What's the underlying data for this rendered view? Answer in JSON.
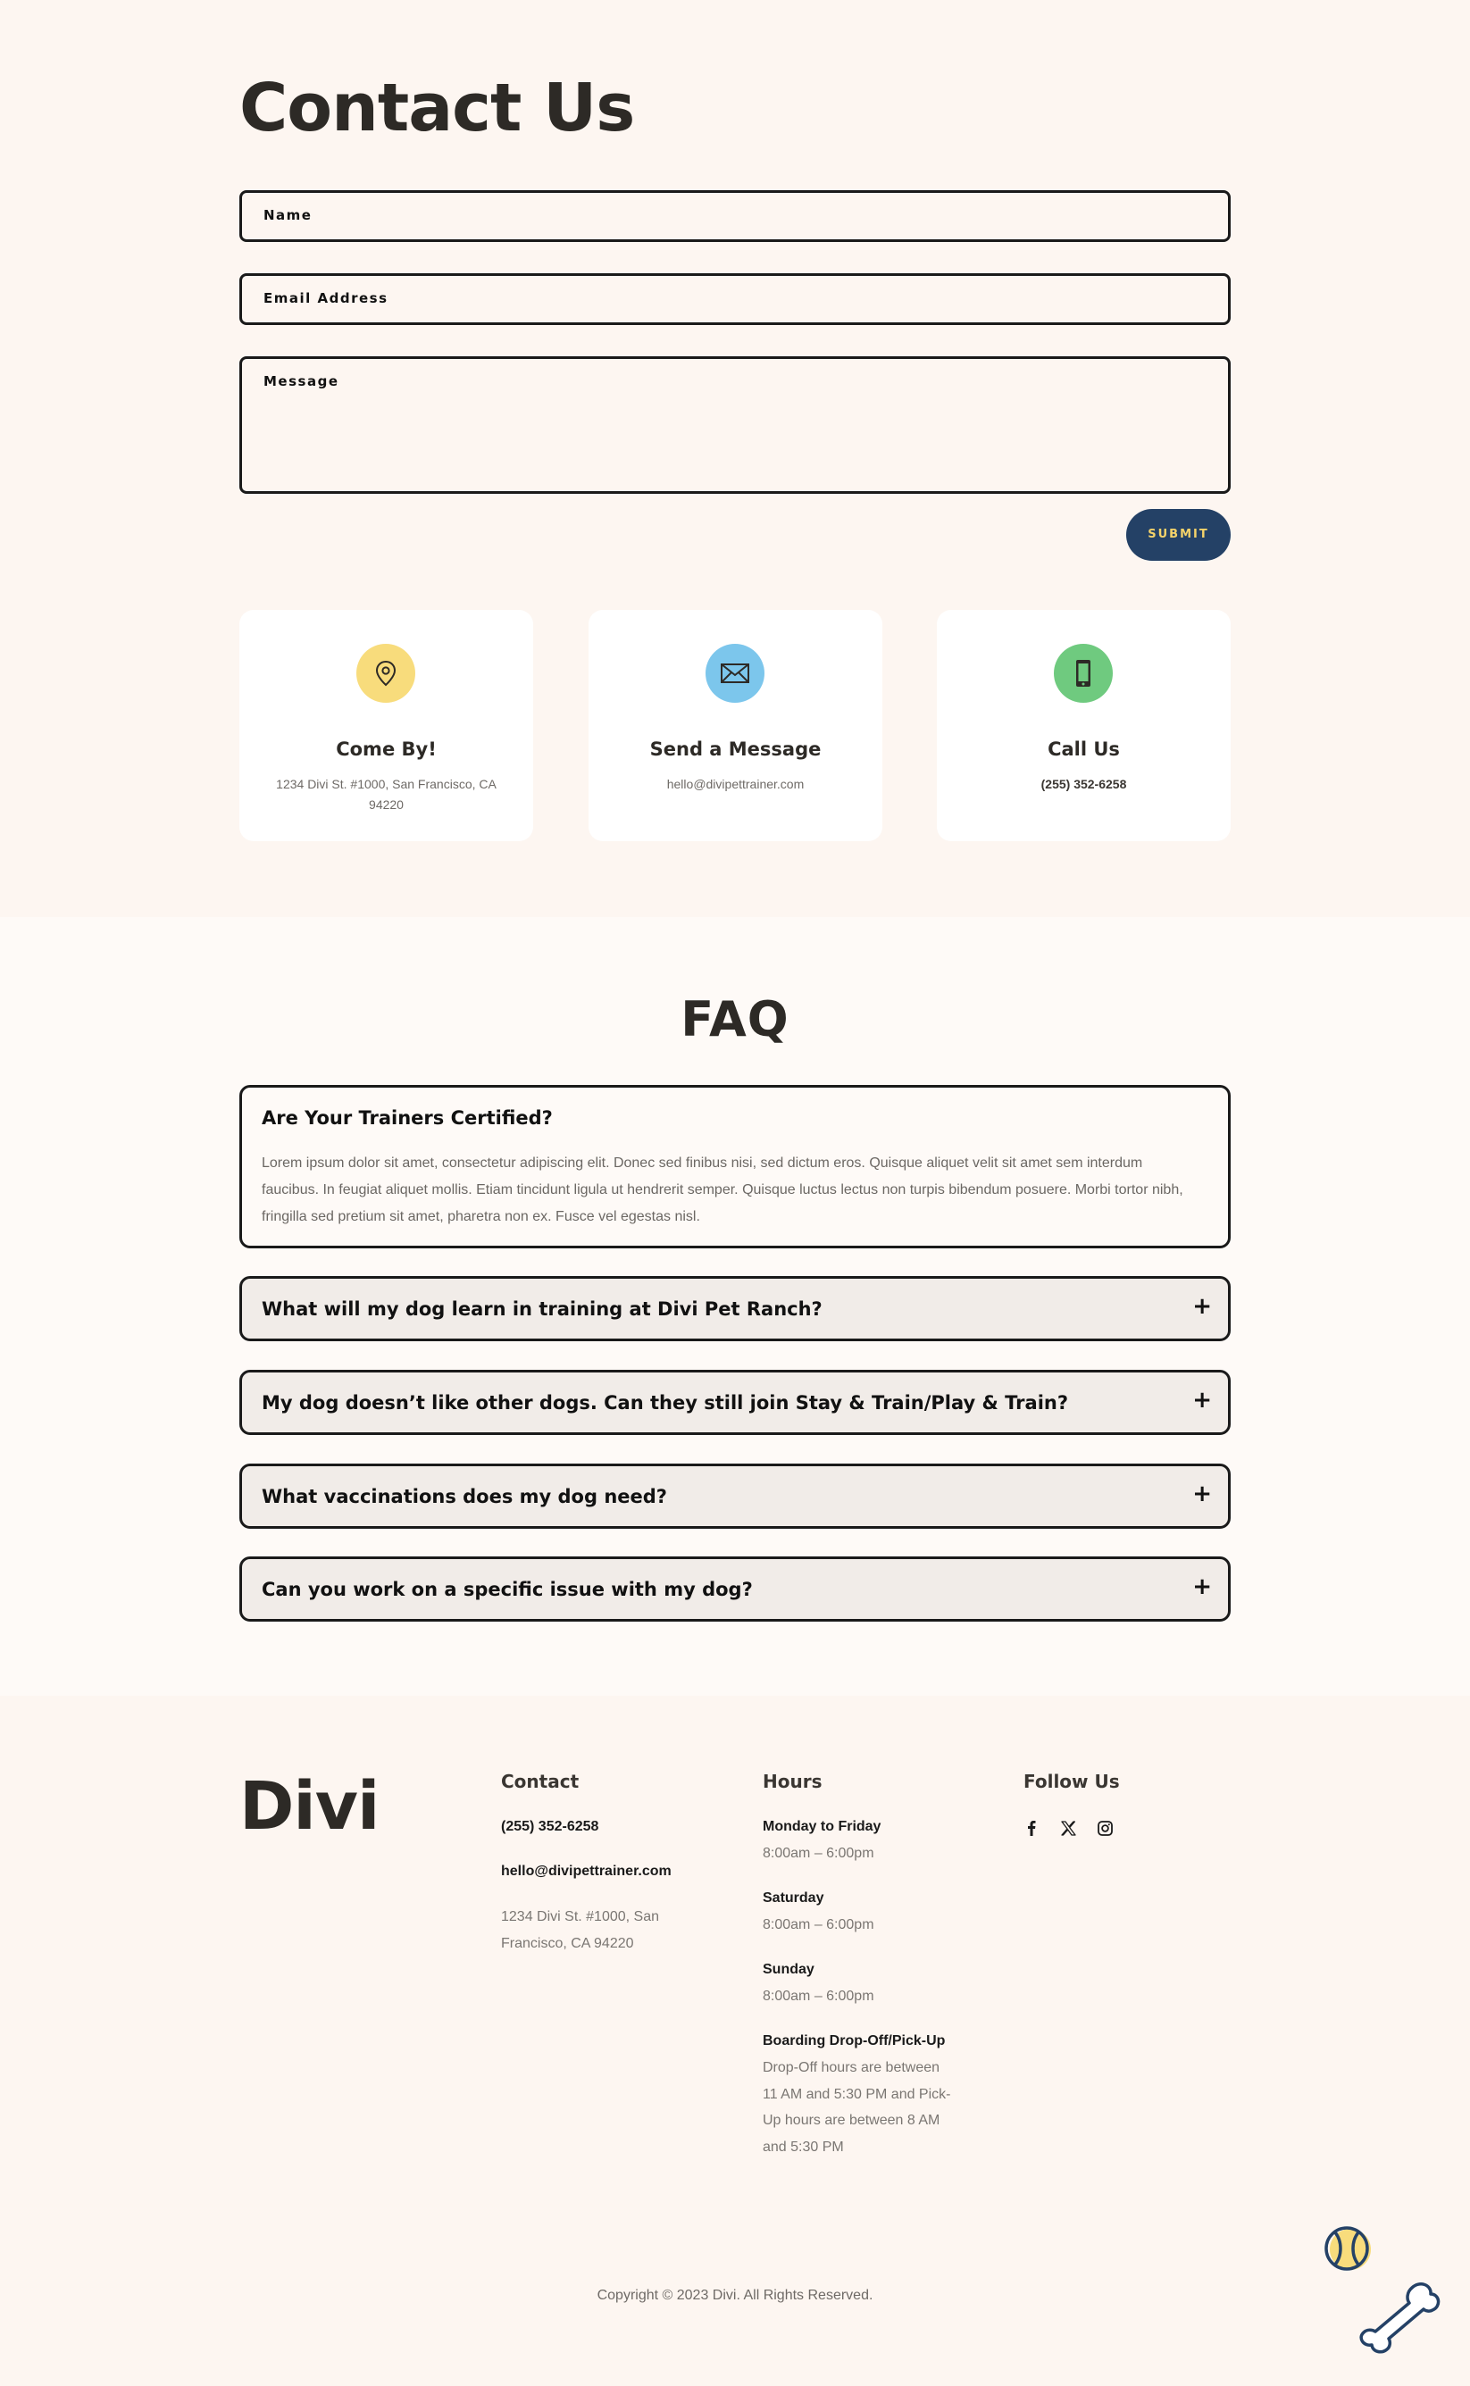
{
  "contact": {
    "title": "Contact Us",
    "fields": {
      "name": "Name",
      "email": "Email Address",
      "message": "Message"
    },
    "submit_label": "SUBMIT",
    "cards": [
      {
        "icon": "map-pin-icon",
        "title": "Come By!",
        "text": "1234 Divi St. #1000, San Francisco, CA 94220",
        "color": "#f8dc7c"
      },
      {
        "icon": "envelope-icon",
        "title": "Send a Message",
        "text": "hello@divipettrainer.com",
        "color": "#7cc6ec"
      },
      {
        "icon": "phone-icon",
        "title": "Call Us",
        "text": "(255) 352-6258",
        "color": "#6fca7f"
      }
    ]
  },
  "faq": {
    "title": "FAQ",
    "items": [
      {
        "question": "Are Your Trainers Certified?",
        "answer": "Lorem ipsum dolor sit amet, consectetur adipiscing elit. Donec sed finibus nisi, sed dictum eros. Quisque aliquet velit sit amet sem interdum faucibus. In feugiat aliquet mollis. Etiam tincidunt ligula ut hendrerit semper. Quisque luctus lectus non turpis bibendum posuere. Morbi tortor nibh, fringilla sed pretium sit amet, pharetra non ex. Fusce vel egestas nisl.",
        "open": true
      },
      {
        "question": "What will my dog learn in training at Divi Pet Ranch?",
        "open": false
      },
      {
        "question": "My dog doesn’t like other dogs. Can they still join Stay & Train/Play & Train?",
        "open": false
      },
      {
        "question": "What vaccinations does my dog need?",
        "open": false
      },
      {
        "question": "Can you work on a specific issue with my dog?",
        "open": false
      }
    ],
    "toggle_symbol": "+"
  },
  "footer": {
    "logo": "Divi",
    "contact": {
      "title": "Contact",
      "phone": "(255) 352-6258",
      "email": "hello@divipettrainer.com",
      "address_line1": "1234 Divi St. #1000, San",
      "address_line2": "Francisco, CA 94220"
    },
    "hours": {
      "title": "Hours",
      "mf_label": "Monday to Friday",
      "mf_time": "8:00am – 6:00pm",
      "sat_label": "Saturday",
      "sat_time": "8:00am – 6:00pm",
      "sun_label": "Sunday",
      "sun_time": "8:00am – 6:00pm",
      "boarding_label": "Boarding Drop-Off/Pick-Up",
      "boarding_lines": [
        "Drop-Off hours are between",
        "11 AM and 5:30 PM and Pick-",
        "Up hours are between 8 AM",
        "and 5:30 PM"
      ]
    },
    "follow": {
      "title": "Follow Us",
      "icons": [
        "facebook-icon",
        "x-twitter-icon",
        "instagram-icon"
      ]
    },
    "copyright": "Copyright © 2023 Divi. All Rights Reserved."
  },
  "colors": {
    "accent_navy": "#244166",
    "accent_yellow": "#f5d36a",
    "background": "#fdf6f1"
  }
}
